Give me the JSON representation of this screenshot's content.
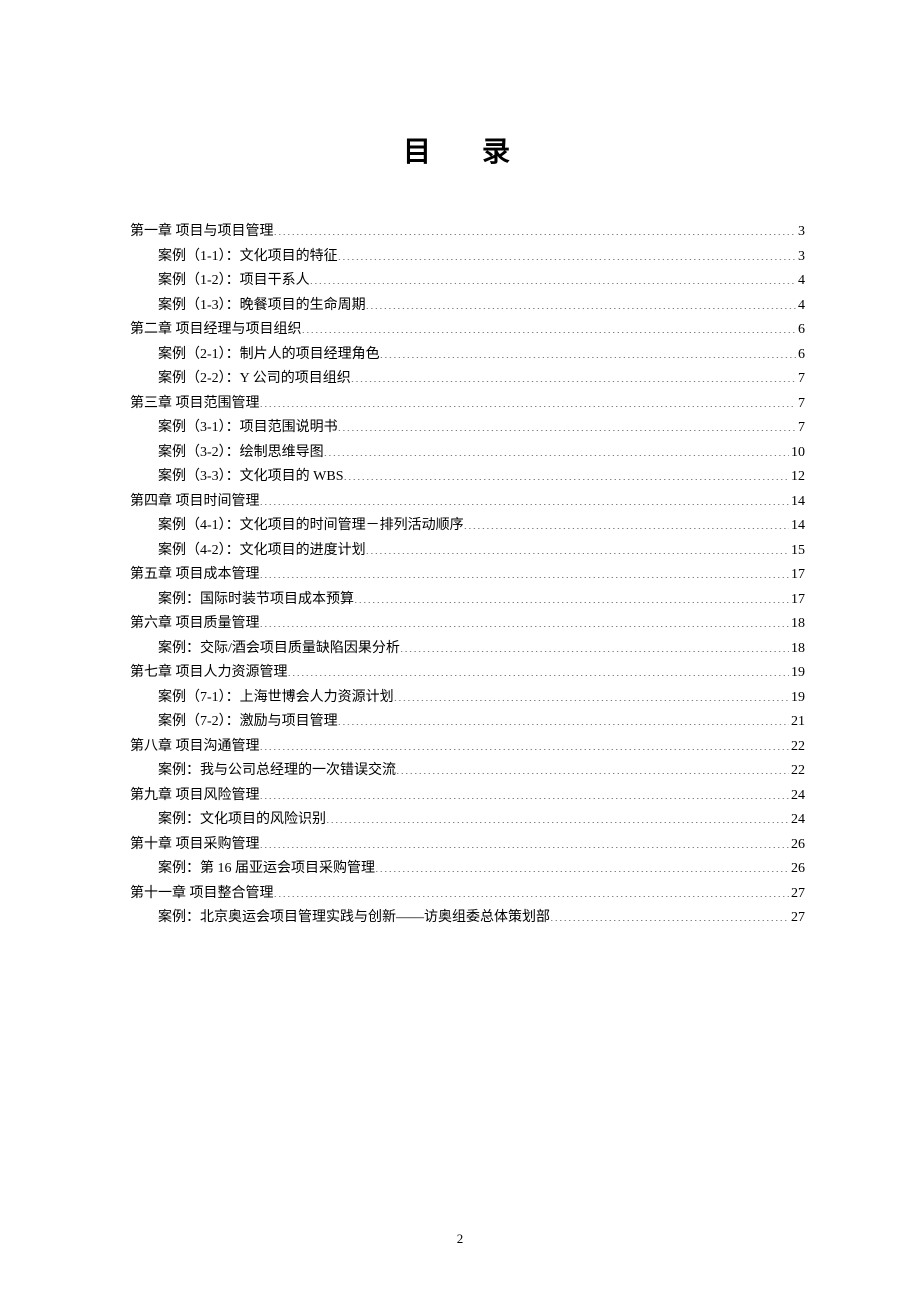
{
  "title": "目 录",
  "page_number": "2",
  "toc": [
    {
      "label": "第一章   项目与项目管理",
      "page": "3",
      "indent": 0
    },
    {
      "label": "案例（1-1）：文化项目的特征 ",
      "page": "3",
      "indent": 1
    },
    {
      "label": "案例（1-2）：项目干系人 ",
      "page": "4",
      "indent": 1
    },
    {
      "label": "案例（1-3）：晚餐项目的生命周期 ",
      "page": "4",
      "indent": 1
    },
    {
      "label": "第二章   项目经理与项目组织",
      "page": "6",
      "indent": 0
    },
    {
      "label": "案例（2-1）：制片人的项目经理角色 ",
      "page": "6",
      "indent": 1
    },
    {
      "label": "案例（2-2）：Y 公司的项目组织 ",
      "page": "7",
      "indent": 1
    },
    {
      "label": "第三章   项目范围管理",
      "page": "7",
      "indent": 0
    },
    {
      "label": "案例（3-1）：项目范围说明书 ",
      "page": "7",
      "indent": 1
    },
    {
      "label": "案例（3-2）：绘制思维导图 ",
      "page": "10",
      "indent": 1
    },
    {
      "label": "案例（3-3）：文化项目的 WBS",
      "page": "12",
      "indent": 1
    },
    {
      "label": "第四章   项目时间管理",
      "page": "14",
      "indent": 0
    },
    {
      "label": "案例（4-1）：文化项目的时间管理－排列活动顺序 ",
      "page": "14",
      "indent": 1
    },
    {
      "label": "案例（4-2）：文化项目的进度计划 ",
      "page": "15",
      "indent": 1
    },
    {
      "label": "第五章   项目成本管理",
      "page": "17",
      "indent": 0
    },
    {
      "label": "案例：国际时装节项目成本预算",
      "page": "17",
      "indent": 1
    },
    {
      "label": "第六章   项目质量管理",
      "page": "18",
      "indent": 0
    },
    {
      "label": "案例：交际/酒会项目质量缺陷因果分析 ",
      "page": "18",
      "indent": 1
    },
    {
      "label": "第七章   项目人力资源管理",
      "page": "19",
      "indent": 0
    },
    {
      "label": "案例（7-1）：上海世博会人力资源计划 ",
      "page": "19",
      "indent": 1
    },
    {
      "label": "案例（7-2）：激励与项目管理 ",
      "page": "21",
      "indent": 1
    },
    {
      "label": "第八章   项目沟通管理",
      "page": "22",
      "indent": 0
    },
    {
      "label": "案例：我与公司总经理的一次错误交流",
      "page": "22",
      "indent": 1
    },
    {
      "label": "第九章   项目风险管理",
      "page": "24",
      "indent": 0
    },
    {
      "label": "案例：文化项目的风险识别",
      "page": "24",
      "indent": 1
    },
    {
      "label": "第十章   项目采购管理",
      "page": "26",
      "indent": 0
    },
    {
      "label": "案例：第 16 届亚运会项目采购管理",
      "page": "26",
      "indent": 1
    },
    {
      "label": "第十一章   项目整合管理",
      "page": "27",
      "indent": 0
    },
    {
      "label": "案例：北京奥运会项目管理实践与创新——访奥组委总体策划部",
      "page": "27",
      "indent": 1
    }
  ]
}
